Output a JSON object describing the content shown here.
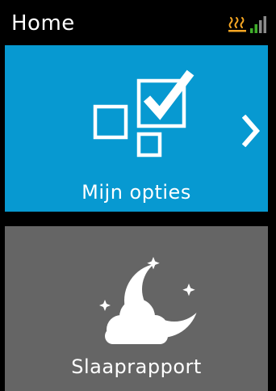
{
  "header": {
    "title": "Home",
    "icons": [
      "heating-icon",
      "signal-strength-icon"
    ]
  },
  "colors": {
    "background": "#000000",
    "options_tile": "#0799d1",
    "sleep_tile": "#656565",
    "heat_icon": "#f5a623",
    "signal_active": "#3fae2a",
    "signal_inactive": "#8a8a8a"
  },
  "tiles": [
    {
      "label": "Mijn opties",
      "icon": "checkbox-options-icon",
      "has_chevron": true
    },
    {
      "label": "Slaaprapport",
      "icon": "moon-cloud-icon",
      "has_chevron": false
    }
  ],
  "signal": {
    "bars_active": 2,
    "bars_total": 4
  }
}
